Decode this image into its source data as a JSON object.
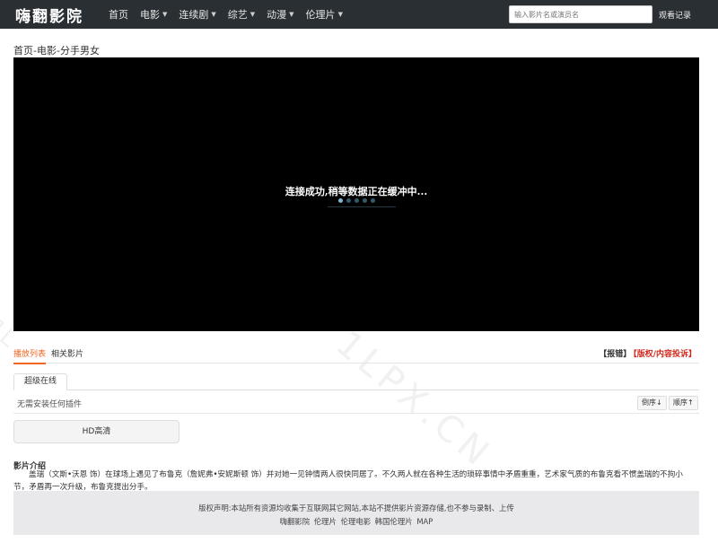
{
  "header": {
    "logo": "嗨翻影院",
    "nav": [
      {
        "label": "首页",
        "has_dropdown": false
      },
      {
        "label": "电影",
        "has_dropdown": true
      },
      {
        "label": "连续剧",
        "has_dropdown": true
      },
      {
        "label": "综艺",
        "has_dropdown": true
      },
      {
        "label": "动漫",
        "has_dropdown": true
      },
      {
        "label": "伦理片",
        "has_dropdown": true
      }
    ],
    "search_placeholder": "输入影片名或演员名",
    "history_label": "观看记录"
  },
  "breadcrumb": "首页-电影-分手男女",
  "player": {
    "loading_text": "连接成功,稍等数据正在缓冲中..."
  },
  "tabs": {
    "playlist": "播放列表",
    "related": "相关影片",
    "report": "【报错】",
    "copyright_report": "【版权/内容投诉】"
  },
  "source": {
    "tab_label": "超级在线",
    "plugin_note": "无需安装任何插件",
    "sort_desc": "倒序↓",
    "sort_asc": "顺序↑",
    "episodes": [
      "HD高清"
    ]
  },
  "intro": {
    "title": "影片介绍",
    "text": "盖瑞（文斯•沃恩 饰）在球场上遇见了布鲁克（詹妮弗•安妮斯顿 饰）并对她一见钟情两人很快同居了。不久两人就在各种生活的琐碎事情中矛盾重重，艺术家气质的布鲁克看不惯盖瑞的不拘小节，矛盾再一次升级，布鲁克提出分手。"
  },
  "footer": {
    "notice": "版权声明:本站所有资源均收集于互联网其它网站,本站不提供影片资源存储,也不参与录制、上传",
    "links": [
      "嗨翻影院",
      "伦理片",
      "伦理电影",
      "韩国伦理片",
      "MAP"
    ]
  },
  "watermark": "1LPX.CN",
  "colors": {
    "topbar": "#2a2f33",
    "accent": "#f26522",
    "report_red": "#d2291d"
  }
}
